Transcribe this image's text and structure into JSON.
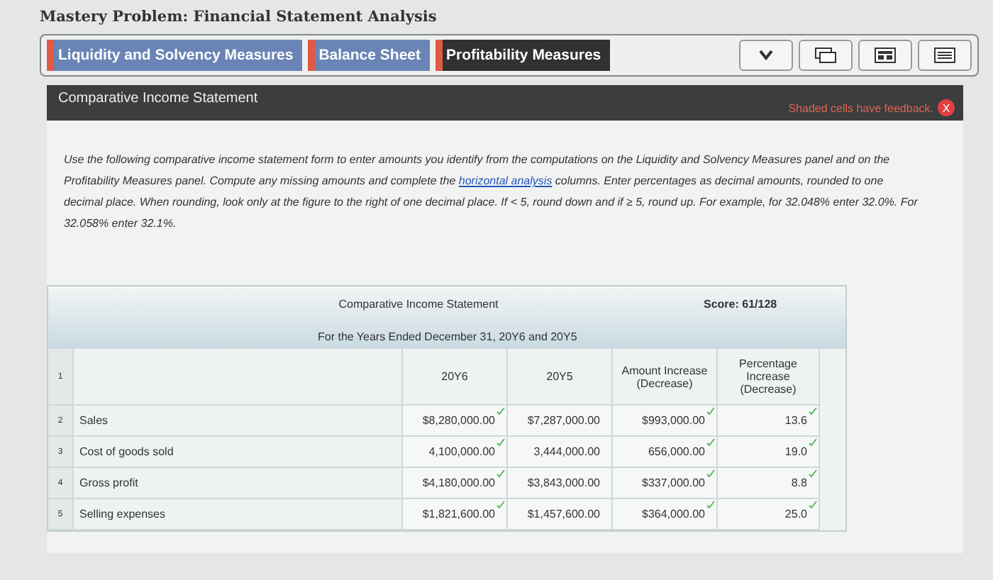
{
  "title": "Mastery Problem: Financial Statement Analysis",
  "tabs": [
    {
      "label": "Liquidity and Solvency Measures",
      "selected": false,
      "flagged": true
    },
    {
      "label": "Balance Sheet",
      "selected": false,
      "flagged": true
    },
    {
      "label": "Profitability Measures",
      "selected": true,
      "flagged": true
    }
  ],
  "panel": {
    "title": "Comparative Income Statement",
    "feedback": "Shaded cells have feedback.",
    "close": "X"
  },
  "instructions_before": "Use the following comparative income statement form to enter amounts you identify from the computations on the Liquidity and Solvency Measures panel and on the Profitability Measures panel. Compute any missing amounts and complete the ",
  "instructions_link": "horizontal analysis",
  "instructions_after": " columns. Enter percentages as decimal amounts, rounded to one decimal place. When rounding, look only at the figure to the right of one decimal place. If < 5, round down and if ≥ 5, round up. For example, for 32.048% enter 32.0%. For 32.058% enter 32.1%.",
  "table": {
    "title": "Comparative Income Statement",
    "subtitle": "For the Years Ended December 31, 20Y6 and 20Y5",
    "score": "Score: 61/128",
    "columns": [
      "20Y6",
      "20Y5",
      "Amount Increase (Decrease)",
      "Percentage Increase (Decrease)"
    ],
    "header_row_number": "1",
    "rows": [
      {
        "number": "2",
        "label": "Sales",
        "cells": [
          {
            "value": "$8,280,000.00",
            "correct": true
          },
          {
            "value": "$7,287,000.00",
            "correct": false
          },
          {
            "value": "$993,000.00",
            "correct": true
          },
          {
            "value": "13.6",
            "correct": true
          }
        ]
      },
      {
        "number": "3",
        "label": "Cost of goods sold",
        "cells": [
          {
            "value": "4,100,000.00",
            "correct": true
          },
          {
            "value": "3,444,000.00",
            "correct": false
          },
          {
            "value": "656,000.00",
            "correct": true
          },
          {
            "value": "19.0",
            "correct": true
          }
        ]
      },
      {
        "number": "4",
        "label": "Gross profit",
        "cells": [
          {
            "value": "$4,180,000.00",
            "correct": true
          },
          {
            "value": "$3,843,000.00",
            "correct": false
          },
          {
            "value": "$337,000.00",
            "correct": true
          },
          {
            "value": "8.8",
            "correct": true
          }
        ]
      },
      {
        "number": "5",
        "label": "Selling expenses",
        "cells": [
          {
            "value": "$1,821,600.00",
            "correct": true
          },
          {
            "value": "$1,457,600.00",
            "correct": false
          },
          {
            "value": "$364,000.00",
            "correct": true
          },
          {
            "value": "25.0",
            "correct": true
          }
        ]
      }
    ]
  }
}
